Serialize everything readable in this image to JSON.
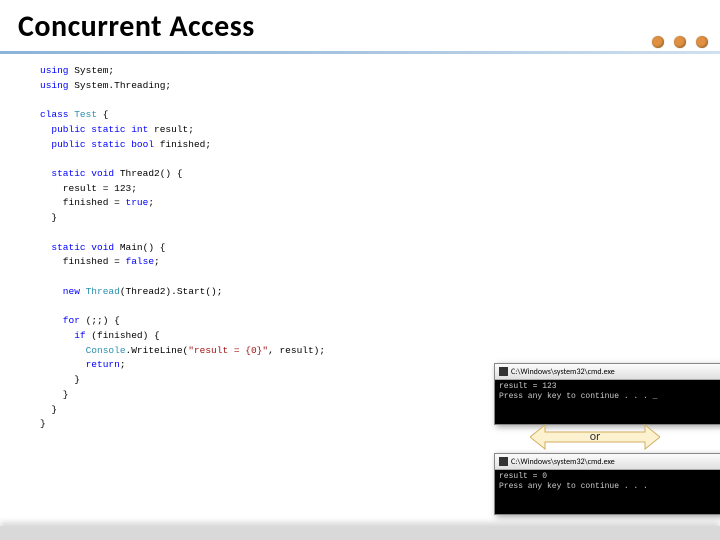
{
  "title": "Concurrent Access",
  "code": {
    "l1a": "using",
    "l1b": " System;",
    "l2a": "using",
    "l2b": " System.Threading;",
    "l3a": "class ",
    "l3b": "Test",
    "l3c": " {",
    "l4a": "  public static int",
    "l4b": " result;",
    "l5a": "  public static bool",
    "l5b": " finished;",
    "l6a": "  static void",
    "l6b": " Thread2() {",
    "l7": "    result = 123;",
    "l8a": "    finished = ",
    "l8b": "true",
    "l8c": ";",
    "l9": "  }",
    "l10a": "  static void",
    "l10b": " Main() {",
    "l11a": "    finished = ",
    "l11b": "false",
    "l11c": ";",
    "l12a": "    new ",
    "l12b": "Thread",
    "l12c": "(Thread2).Start();",
    "l13a": "    for",
    "l13b": " (;;) {",
    "l14a": "      if",
    "l14b": " (finished) {",
    "l15a": "        Console",
    "l15b": ".WriteLine(",
    "l15c": "\"result = {0}\"",
    "l15d": ", result);",
    "l16a": "        return",
    "l16b": ";",
    "l17": "      }",
    "l18": "    }",
    "l19": "  }",
    "l20": "}"
  },
  "cmd1": {
    "title": "C:\\Windows\\system32\\cmd.exe",
    "line1": "result = 123",
    "line2": "Press any key to continue . . . _"
  },
  "cmd2": {
    "title": "C:\\Windows\\system32\\cmd.exe",
    "line1": "result = 0",
    "line2": "Press any key to continue . . ."
  },
  "or_label": "or"
}
